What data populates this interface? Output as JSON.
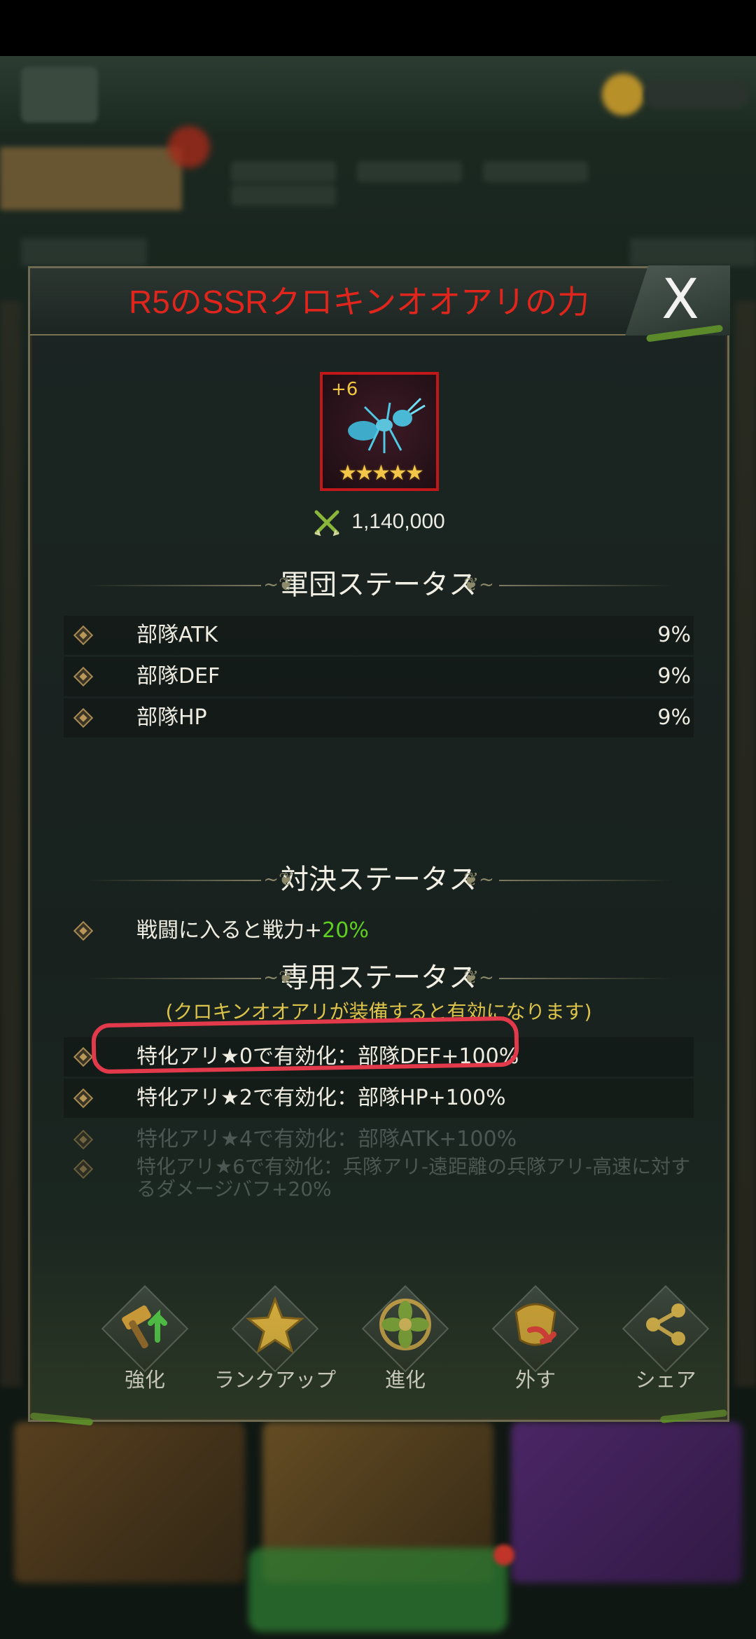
{
  "dialog": {
    "title": "R5のSSRクロキンオオアリの力",
    "close_label": "X",
    "item": {
      "level": "+6",
      "stars": "★★★★★",
      "star_count": 5
    },
    "power": "1,140,000",
    "army_section": {
      "title": "軍団ステータス",
      "rows": [
        {
          "label": "部隊ATK",
          "value": "9%"
        },
        {
          "label": "部隊DEF",
          "value": "9%"
        },
        {
          "label": "部隊HP",
          "value": "9%"
        }
      ]
    },
    "duel_section": {
      "title": "対決ステータス",
      "row_prefix": "戦闘に入ると戦力+",
      "row_value": "20%"
    },
    "exclusive_section": {
      "title": "専用ステータス",
      "note": "(クロキンオオアリが装備すると有効になります)",
      "rows": [
        {
          "label": "特化アリ★0で有効化：部隊DEF+100%"
        },
        {
          "label": "特化アリ★2で有効化：部隊HP+100%"
        },
        {
          "label": "特化アリ★4で有効化：部隊ATK+100%"
        },
        {
          "label": "特化アリ★6で有効化：兵隊アリ-遠距離の兵隊アリ-高速に対す",
          "label_line2": "るダメージバフ+20%"
        }
      ]
    },
    "actions": [
      {
        "label": "強化",
        "icon": "hammer-upgrade-icon"
      },
      {
        "label": "ランクアップ",
        "icon": "star-icon"
      },
      {
        "label": "進化",
        "icon": "flower-emblem-icon"
      },
      {
        "label": "外す",
        "icon": "unequip-icon"
      },
      {
        "label": "シェア",
        "icon": "share-icon"
      }
    ]
  },
  "colors": {
    "title_red": "#e0251d",
    "highlight_red": "#e23a4a",
    "accent_green": "#5fd022",
    "note_yellow": "#dcc34a",
    "star_gold": "#f3c64a"
  }
}
